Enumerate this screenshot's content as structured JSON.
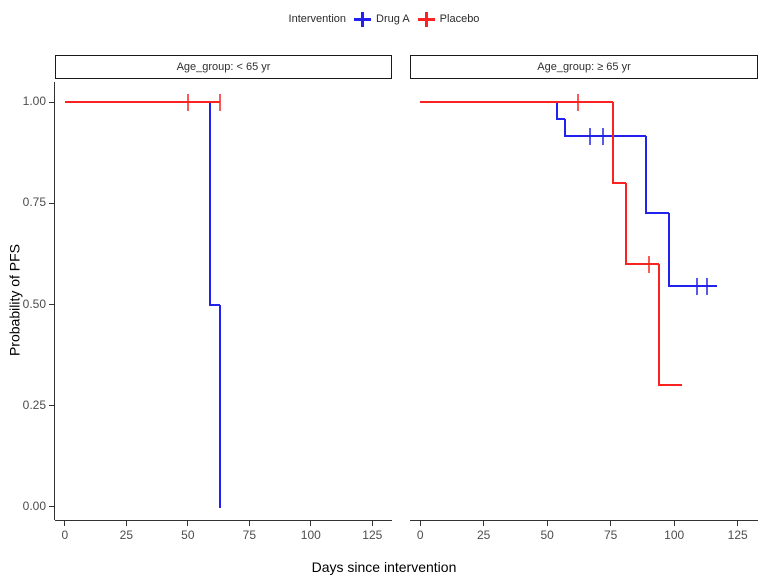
{
  "legend": {
    "title": "Intervention",
    "entries": [
      {
        "label": "Drug A",
        "color": "#2222ee",
        "key": "plus-marker"
      },
      {
        "label": "Placebo",
        "color": "#fb2222",
        "key": "plus-marker"
      }
    ]
  },
  "axes": {
    "x_label": "Days since intervention",
    "y_label": "Probability of PFS",
    "x_ticks": [
      "0",
      "25",
      "50",
      "75",
      "100",
      "125"
    ],
    "y_ticks": [
      "0.00",
      "0.25",
      "0.50",
      "0.75",
      "1.00"
    ]
  },
  "facets": [
    {
      "label": "Age_group: < 65 yr"
    },
    {
      "label": "Age_group: ≥ 65 yr"
    }
  ],
  "chart_data": {
    "type": "line",
    "plot_kind": "kaplan-meier-step",
    "title": "",
    "xlabel": "Days since intervention",
    "ylabel": "Probability of PFS",
    "xlim": [
      -4,
      133
    ],
    "ylim": [
      -0.03,
      1.05
    ],
    "x_ticks": [
      0,
      25,
      50,
      75,
      100,
      125
    ],
    "y_ticks": [
      0.0,
      0.25,
      0.5,
      0.75,
      1.0
    ],
    "grid": false,
    "legend_position": "top",
    "facet_variable": "Age_group",
    "series_variable": "Intervention",
    "panels": [
      {
        "facet": "Age_group: < 65 yr",
        "series": [
          {
            "name": "Drug A",
            "color": "#2222ee",
            "steps": [
              {
                "x": 0,
                "y": 1.0
              },
              {
                "x": 59,
                "y": 1.0
              },
              {
                "x": 59,
                "y": 0.5
              },
              {
                "x": 63,
                "y": 0.5
              },
              {
                "x": 63,
                "y": 0.0
              }
            ],
            "censor_times": []
          },
          {
            "name": "Placebo",
            "color": "#fb2222",
            "steps": [
              {
                "x": 0,
                "y": 1.0
              },
              {
                "x": 63,
                "y": 1.0
              }
            ],
            "censor_times": [
              50,
              63
            ]
          }
        ]
      },
      {
        "facet": "Age_group: ≥ 65 yr",
        "series": [
          {
            "name": "Drug A",
            "color": "#2222ee",
            "steps": [
              {
                "x": 0,
                "y": 1.0
              },
              {
                "x": 54,
                "y": 1.0
              },
              {
                "x": 54,
                "y": 0.958
              },
              {
                "x": 57,
                "y": 0.958
              },
              {
                "x": 57,
                "y": 0.917
              },
              {
                "x": 89,
                "y": 0.917
              },
              {
                "x": 89,
                "y": 0.727
              },
              {
                "x": 98,
                "y": 0.727
              },
              {
                "x": 98,
                "y": 0.545
              },
              {
                "x": 117,
                "y": 0.545
              }
            ],
            "censor_times": [
              67,
              72,
              109,
              113
            ]
          },
          {
            "name": "Placebo",
            "color": "#fb2222",
            "steps": [
              {
                "x": 0,
                "y": 1.0
              },
              {
                "x": 76,
                "y": 1.0
              },
              {
                "x": 76,
                "y": 0.8
              },
              {
                "x": 81,
                "y": 0.8
              },
              {
                "x": 81,
                "y": 0.6
              },
              {
                "x": 94,
                "y": 0.6
              },
              {
                "x": 94,
                "y": 0.3
              },
              {
                "x": 103,
                "y": 0.3
              }
            ],
            "censor_times": [
              62,
              90
            ]
          }
        ]
      }
    ]
  }
}
